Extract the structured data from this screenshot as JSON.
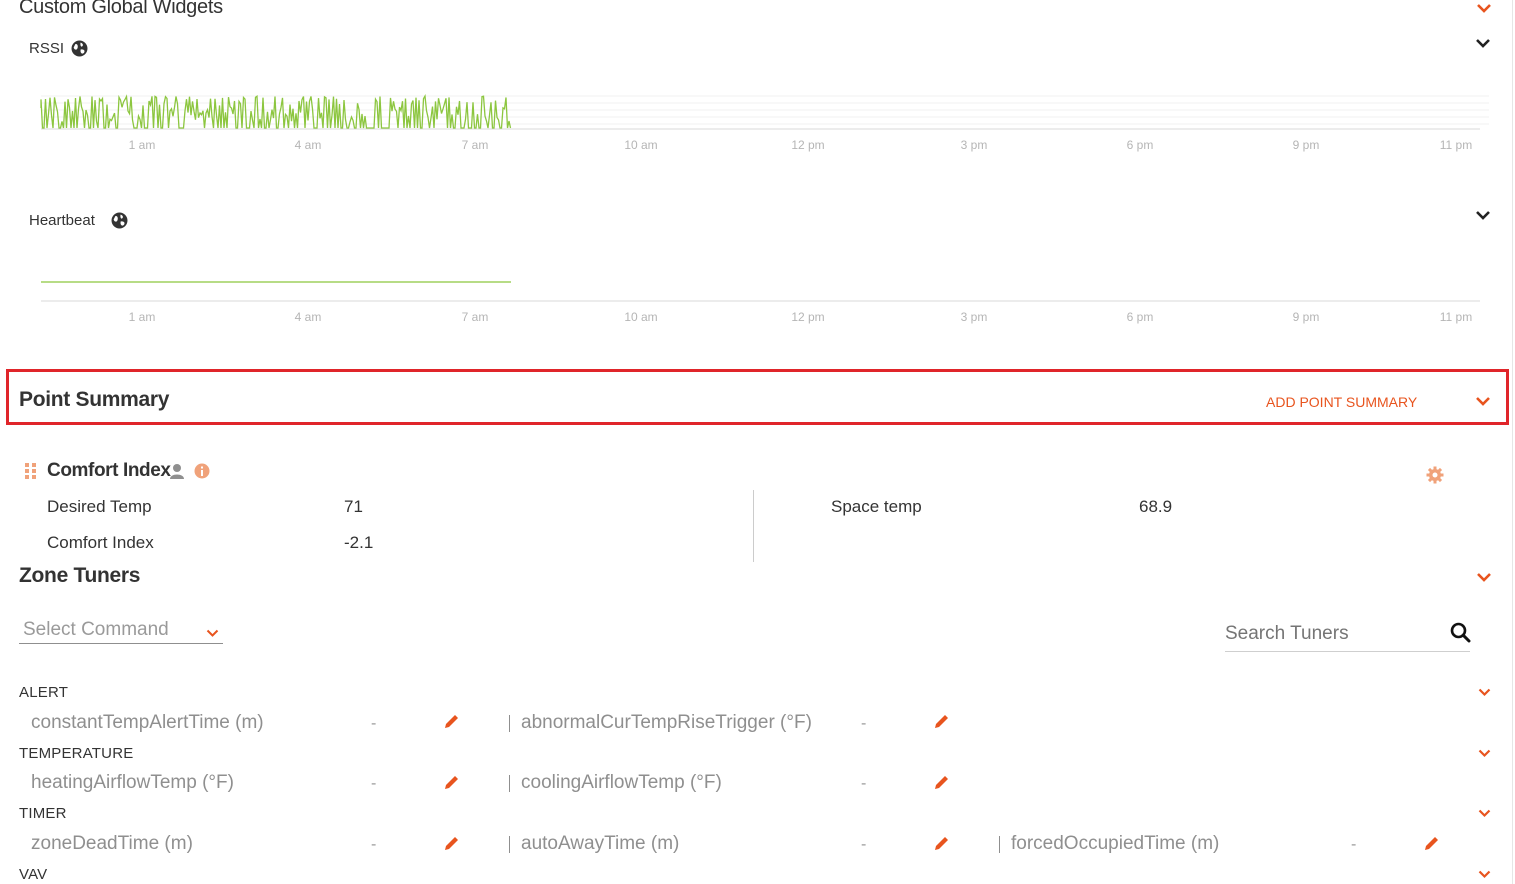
{
  "widgets": {
    "title": "Custom Global Widgets",
    "rssi": {
      "label": "RSSI",
      "ticks": [
        "1 am",
        "4 am",
        "7 am",
        "10 am",
        "12 pm",
        "3 pm",
        "6 pm",
        "9 pm",
        "11 pm"
      ]
    },
    "heartbeat": {
      "label": "Heartbeat",
      "ticks": [
        "1 am",
        "4 am",
        "7 am",
        "10 am",
        "12 pm",
        "3 pm",
        "6 pm",
        "9 pm",
        "11 pm"
      ]
    }
  },
  "point_summary": {
    "title": "Point Summary",
    "add_label": "ADD POINT SUMMARY",
    "card": {
      "title": "Comfort Index",
      "left": [
        {
          "label": "Desired Temp",
          "value": "71"
        },
        {
          "label": "Comfort Index",
          "value": "-2.1"
        }
      ],
      "right": [
        {
          "label": "Space temp",
          "value": "68.9"
        }
      ]
    }
  },
  "zone_tuners": {
    "title": "Zone Tuners",
    "select_placeholder": "Select Command",
    "search_placeholder": "Search Tuners",
    "groups": [
      {
        "name": "ALERT",
        "items": [
          {
            "label": "constantTempAlertTime (m)",
            "value": "-"
          },
          {
            "label": "abnormalCurTempRiseTrigger (°F)",
            "value": "-"
          }
        ]
      },
      {
        "name": "TEMPERATURE",
        "items": [
          {
            "label": "heatingAirflowTemp (°F)",
            "value": "-"
          },
          {
            "label": "coolingAirflowTemp (°F)",
            "value": "-"
          }
        ]
      },
      {
        "name": "TIMER",
        "items": [
          {
            "label": "zoneDeadTime (m)",
            "value": "-"
          },
          {
            "label": "autoAwayTime (m)",
            "value": "-"
          },
          {
            "label": "forcedOccupiedTime (m)",
            "value": "-"
          }
        ]
      },
      {
        "name": "VAV",
        "items": []
      }
    ]
  },
  "colors": {
    "accent": "#e8541e",
    "chart_line": "#8cc63f",
    "highlight": "#e0252a"
  },
  "icons": [
    "chevron-down-icon",
    "globe-icon",
    "drag-handle-icon",
    "user-icon",
    "info-icon",
    "gear-icon",
    "search-icon",
    "pencil-icon"
  ]
}
